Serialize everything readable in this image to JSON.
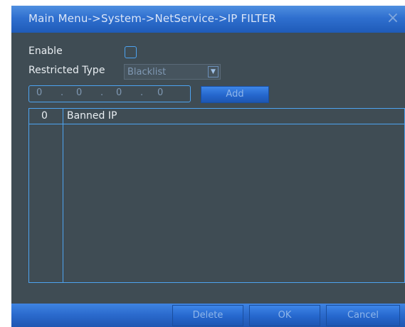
{
  "window": {
    "title": "Main Menu->System->NetService->IP FILTER",
    "close_glyph": "×"
  },
  "form": {
    "enable_label": "Enable",
    "enable_checked": false,
    "restricted_type_label": "Restricted Type",
    "restricted_type_value": "Blacklist",
    "ip_octets": [
      "0",
      "0",
      "0",
      "0"
    ],
    "ip_separator": ".",
    "add_label": "Add"
  },
  "table": {
    "columns": [
      "0",
      "Banned IP"
    ],
    "rows": []
  },
  "footer": {
    "delete_label": "Delete",
    "ok_label": "OK",
    "cancel_label": "Cancel"
  },
  "icons": {
    "dropdown": "chevron-down-icon",
    "close": "close-icon"
  },
  "colors": {
    "panel_bg": "#3f4c54",
    "accent_blue": "#2f6fcf",
    "border_blue": "#4da3f0",
    "label_text": "#e9eef2",
    "muted_text": "#7f98b3"
  }
}
